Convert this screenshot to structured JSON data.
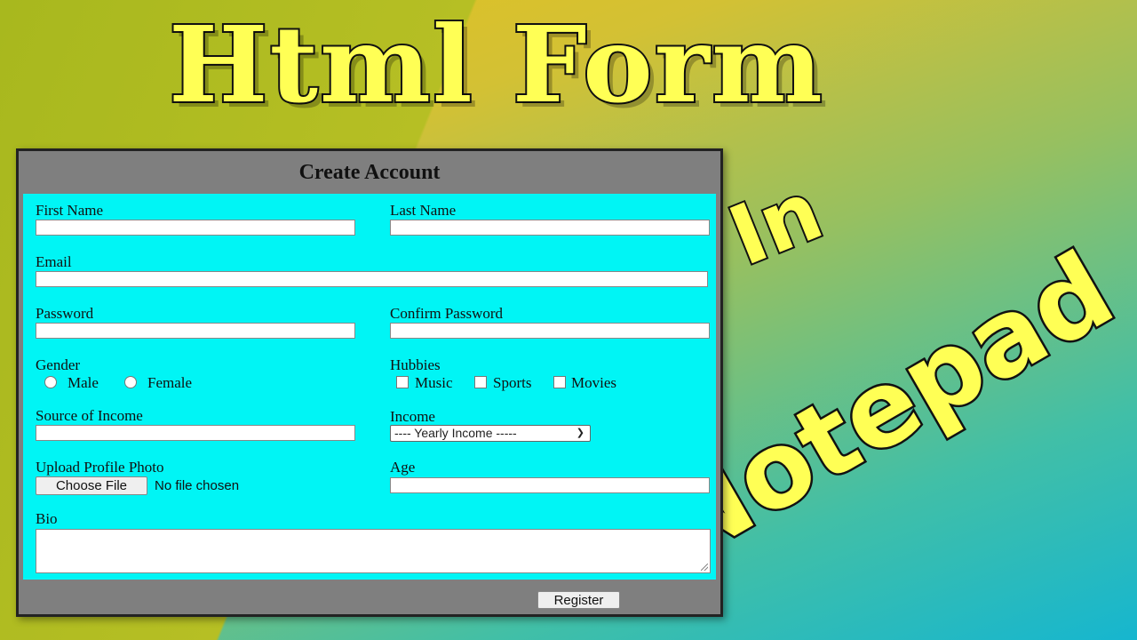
{
  "thumbnail": {
    "title": "Html Form",
    "subtitle_in": "In",
    "subtitle_app": "Notepad"
  },
  "form": {
    "header": "Create Account",
    "first_name_label": "First Name",
    "last_name_label": "Last Name",
    "email_label": "Email",
    "password_label": "Password",
    "confirm_password_label": "Confirm Password",
    "gender_label": "Gender",
    "gender_options": [
      "Male",
      "Female"
    ],
    "hobbies_label": "Hubbies",
    "hobby_options": [
      "Music",
      "Sports",
      "Movies"
    ],
    "source_income_label": "Source of Income",
    "income_label": "Income",
    "income_selected": "---- Yearly Income -----",
    "upload_label": "Upload Profile Photo",
    "choose_file_label": "Choose File",
    "file_status": "No file chosen",
    "age_label": "Age",
    "bio_label": "Bio",
    "register_label": "Register"
  },
  "colors": {
    "form_body": "#00f5f5",
    "form_frame": "#7f7f7f",
    "title_text": "#ffff55"
  }
}
